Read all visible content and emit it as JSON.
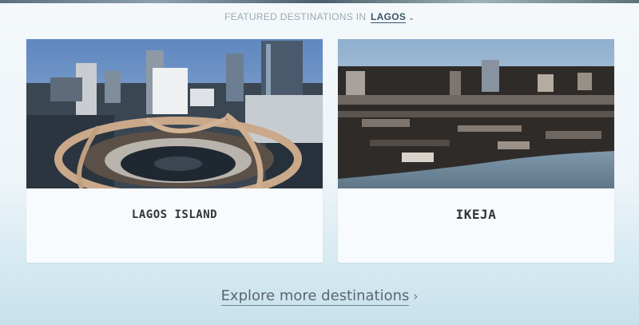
{
  "header": {
    "prefix": "FEATURED DESTINATIONS IN",
    "city": "LAGOS",
    "chevron_icon": "chevron-down-icon"
  },
  "cards": [
    {
      "title": "LAGOS ISLAND",
      "photo": "lagos-island-aerial-photo"
    },
    {
      "title": "IKEJA",
      "photo": "ikeja-cityscape-photo"
    }
  ],
  "footer": {
    "explore_label": "Explore more destinations",
    "chevron_icon": "chevron-right-icon"
  },
  "colors": {
    "heading_muted": "#9aaab3",
    "heading_accent": "#3b5566",
    "card_background": "#f7fbfd",
    "title_text": "#2e3438",
    "link_text": "#5b6670"
  }
}
